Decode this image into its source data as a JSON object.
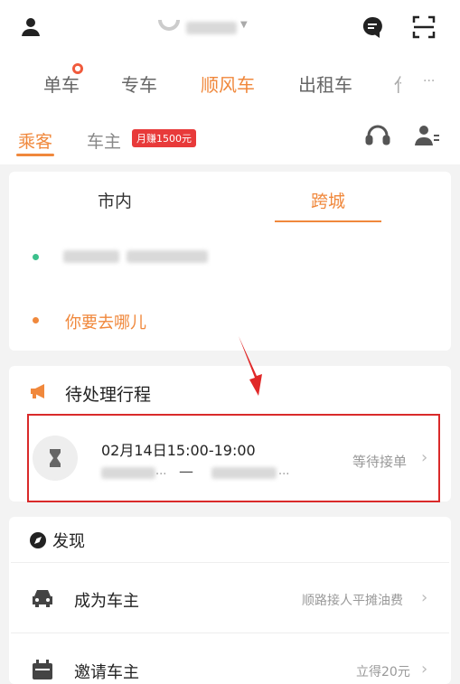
{
  "header": {
    "tabs": [
      {
        "label": "单车",
        "active": false
      },
      {
        "label": "专车",
        "active": false
      },
      {
        "label": "顺风车",
        "active": true
      },
      {
        "label": "出租车",
        "active": false
      },
      {
        "label": "代",
        "active": false
      }
    ],
    "more_label": "···"
  },
  "role": {
    "passenger_label": "乘客",
    "driver_label": "车主",
    "driver_badge": "月赚1500元"
  },
  "route_card": {
    "tabs": [
      {
        "label": "市内",
        "active": false
      },
      {
        "label": "跨城",
        "active": true
      }
    ],
    "destination_placeholder": "你要去哪儿"
  },
  "pending": {
    "title": "待处理行程",
    "trip_time": "02月14日15:00-19:00",
    "arrow": "—",
    "ellipsis_from": "...",
    "ellipsis_to": "...",
    "status": "等待接单"
  },
  "discover": {
    "title": "发现",
    "items": [
      {
        "label": "成为车主",
        "hint": "顺路接人平摊油费"
      },
      {
        "label": "邀请车主",
        "hint": "立得20元"
      }
    ]
  },
  "colors": {
    "accent": "#f0883c",
    "green": "#3cc08c",
    "badge": "#e83a3a",
    "red_box": "#d92a2a"
  }
}
